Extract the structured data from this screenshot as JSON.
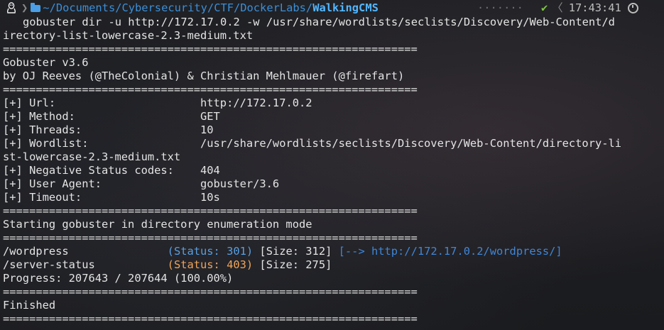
{
  "prompt": {
    "os_icon": "tux-icon",
    "path_prefix": "~/Documents/Cybersecurity/CTF/DockerLabs/",
    "path_current": "WalkingCMS",
    "dots": "·······",
    "status_icon": "✔",
    "angle": "〈",
    "time": "17:43:41"
  },
  "command": {
    "line1": "gobuster dir -u http://172.17.0.2 -w /usr/share/wordlists/seclists/Discovery/Web-Content/d",
    "line2": "irectory-list-lowercase-2.3-medium.txt"
  },
  "separator": "===============================================================",
  "banner": {
    "version": "Gobuster v3.6",
    "authors": "by OJ Reeves (@TheColonial) & Christian Mehlmauer (@firefart)"
  },
  "config": [
    {
      "key": "[+] Url:",
      "value": "http://172.17.0.2"
    },
    {
      "key": "[+] Method:",
      "value": "GET"
    },
    {
      "key": "[+] Threads:",
      "value": "10"
    },
    {
      "key": "[+] Wordlist:",
      "value": "/usr/share/wordlists/seclists/Discovery/Web-Content/directory-li"
    },
    {
      "key": "st-lowercase-2.3-medium.txt",
      "value": ""
    },
    {
      "key": "[+] Negative Status codes:",
      "value": "404"
    },
    {
      "key": "[+] User Agent:",
      "value": "gobuster/3.6"
    },
    {
      "key": "[+] Timeout:",
      "value": "10s"
    }
  ],
  "mode_line": "Starting gobuster in directory enumeration mode",
  "results": [
    {
      "path": "/wordpress",
      "status": "(Status: 301)",
      "size": "[Size: 312]",
      "redirect": "[--> http://172.17.0.2/wordpress/]"
    },
    {
      "path": "/server-status",
      "status": "(Status: 403)",
      "size": "[Size: 275]",
      "redirect": ""
    }
  ],
  "progress": "Progress: 207643 / 207644 (100.00%)",
  "finished": "Finished",
  "colors": {
    "status_301": "#5a9fe0",
    "status_403": "#f0a45a",
    "redirect": "#3f86d8",
    "path_current": "#52b6ff"
  }
}
